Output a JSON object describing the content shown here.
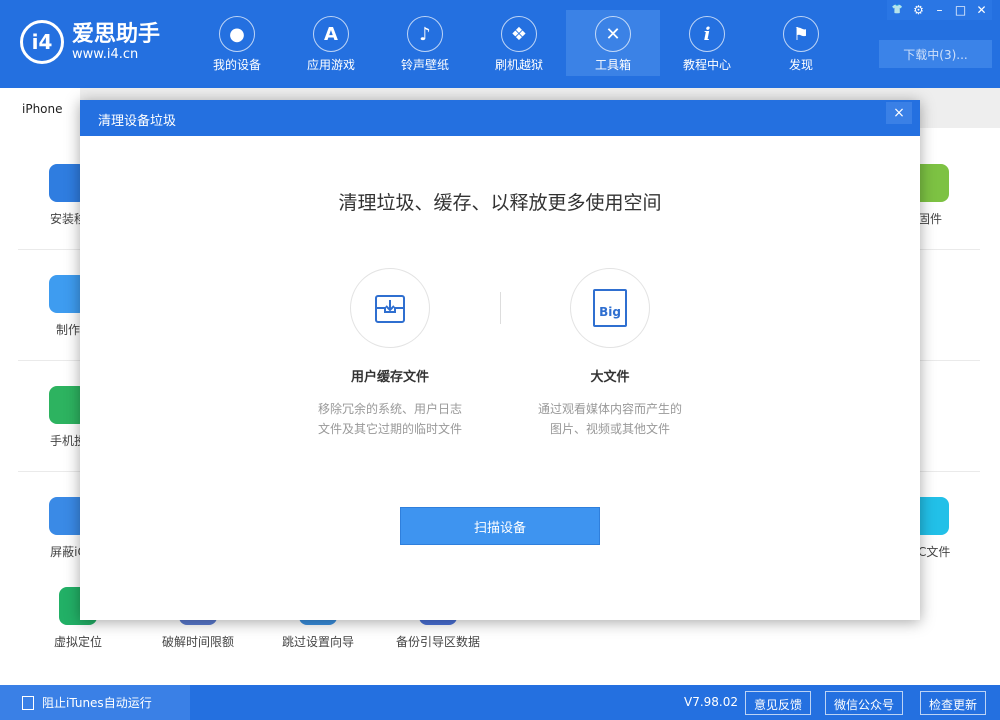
{
  "app": {
    "logo_name": "爱思助手",
    "logo_url": "www.i4.cn",
    "logo_mark": "i4"
  },
  "nav": [
    {
      "label": "我的设备",
      "icon": ""
    },
    {
      "label": "应用游戏",
      "icon": "A"
    },
    {
      "label": "铃声壁纸",
      "icon": "♪"
    },
    {
      "label": "刷机越狱",
      "icon": "❖"
    },
    {
      "label": "工具箱",
      "icon": "✕"
    },
    {
      "label": "教程中心",
      "icon": "i"
    },
    {
      "label": "发现",
      "icon": "⚑"
    }
  ],
  "window_controls": {
    "skin": "👕",
    "settings": "⚙",
    "minimize": "–",
    "maximize": "□",
    "close": "✕"
  },
  "download_label": "下载中(3)...",
  "device_tab": "iPhone",
  "background_tools": {
    "left": [
      "安装移",
      "制作",
      "手机投",
      "屏蔽iC",
      "虚拟定位"
    ],
    "bottom": [
      "破解时间限额",
      "跳过设置向导",
      "备份引导区数据"
    ],
    "right": [
      "固件",
      "CC文件"
    ]
  },
  "dialog": {
    "title": "清理设备垃圾",
    "close": "×",
    "heading": "清理垃圾、缓存、以释放更多使用空间",
    "options": [
      {
        "name": "用户缓存文件",
        "desc1": "移除冗余的系统、用户日志",
        "desc2": "文件及其它过期的临时文件",
        "icon": "inbox-download"
      },
      {
        "name": "大文件",
        "desc1": "通过观看媒体内容而产生的",
        "desc2": "图片、视频或其他文件",
        "icon_text": "Big"
      }
    ],
    "scan_button": "扫描设备"
  },
  "footer": {
    "itunes_label": "阻止iTunes自动运行",
    "version": "V7.98.02",
    "feedback": "意见反馈",
    "wechat": "微信公众号",
    "update": "检查更新"
  },
  "colors": {
    "brand": "#2470e0",
    "button": "#3e94f0"
  }
}
